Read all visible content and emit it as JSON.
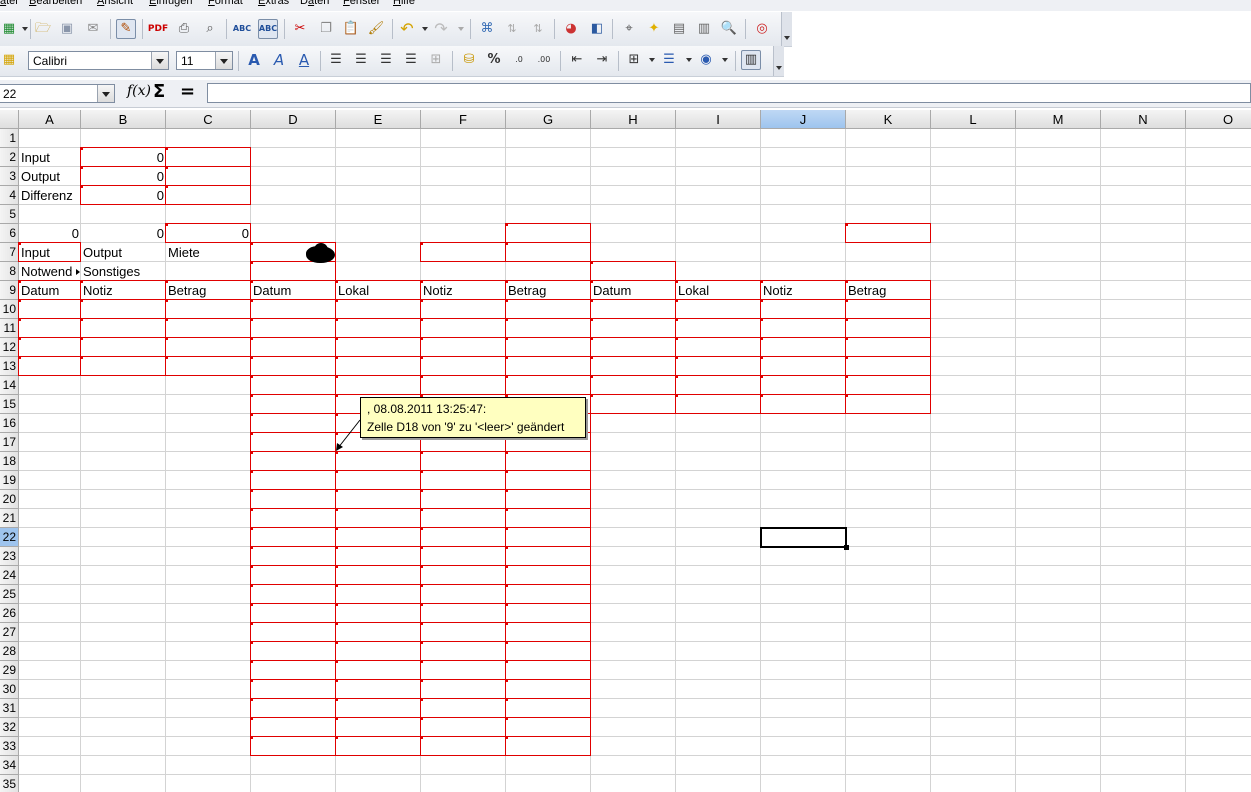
{
  "menu": [
    {
      "label": "atei",
      "underline": 0
    },
    {
      "label": "Bearbeiten",
      "underline": 0
    },
    {
      "label": "Ansicht",
      "underline": 0
    },
    {
      "label": "Einfügen",
      "underline": 0
    },
    {
      "label": "Format",
      "underline": 0
    },
    {
      "label": "Extras",
      "underline": 0
    },
    {
      "label": "Daten",
      "underline": 1
    },
    {
      "label": "Fenster",
      "underline": 0
    },
    {
      "label": "Hilfe",
      "underline": 0
    }
  ],
  "format_toolbar": {
    "font_name": "Calibri",
    "font_size": "11"
  },
  "formula_bar": {
    "cell_ref": "22",
    "content": ""
  },
  "columns": [
    "A",
    "B",
    "C",
    "D",
    "E",
    "F",
    "G",
    "H",
    "I",
    "J",
    "K",
    "L",
    "M",
    "N",
    "O"
  ],
  "rows": [
    "1",
    "2",
    "3",
    "4",
    "5",
    "6",
    "7",
    "8",
    "9",
    "10",
    "11",
    "12",
    "13",
    "14",
    "15",
    "16",
    "17",
    "18",
    "19",
    "20",
    "21",
    "22",
    "23",
    "24",
    "25",
    "26",
    "27",
    "28",
    "29",
    "30",
    "31",
    "32",
    "33",
    "34",
    "35"
  ],
  "row_labels_shown": [
    "1",
    "2",
    "3",
    "4",
    "5",
    "6",
    "7",
    "8",
    "9",
    "10",
    "11",
    "12",
    "13",
    "14",
    "15",
    "16",
    "17",
    "18",
    "19",
    "20",
    "21",
    "22",
    "23",
    "24",
    "25",
    "26",
    "27",
    "28",
    "29",
    "30",
    "31",
    "32",
    "33",
    "34",
    "35"
  ],
  "active": {
    "column": "J",
    "row": "22"
  },
  "cells": [
    {
      "ref": "A2",
      "value": "Input"
    },
    {
      "ref": "B2",
      "value": "0",
      "num": true
    },
    {
      "ref": "A3",
      "value": "Output"
    },
    {
      "ref": "B3",
      "value": "0",
      "num": true
    },
    {
      "ref": "A4",
      "value": "Differenz"
    },
    {
      "ref": "B4",
      "value": "0",
      "num": true
    },
    {
      "ref": "A6",
      "value": "0",
      "num": true
    },
    {
      "ref": "B6",
      "value": "0",
      "num": true
    },
    {
      "ref": "C6",
      "value": "0",
      "num": true
    },
    {
      "ref": "A7",
      "value": "Input"
    },
    {
      "ref": "B7",
      "value": "Output"
    },
    {
      "ref": "C7",
      "value": "Miete"
    },
    {
      "ref": "A8",
      "value": "Notwend"
    },
    {
      "ref": "B8",
      "value": "Sonstiges"
    },
    {
      "ref": "A9",
      "value": "Datum"
    },
    {
      "ref": "B9",
      "value": "Notiz"
    },
    {
      "ref": "C9",
      "value": "Betrag"
    },
    {
      "ref": "D9",
      "value": "Datum"
    },
    {
      "ref": "E9",
      "value": "Lokal"
    },
    {
      "ref": "F9",
      "value": "Notiz"
    },
    {
      "ref": "G9",
      "value": "Betrag"
    },
    {
      "ref": "H9",
      "value": "Datum"
    },
    {
      "ref": "I9",
      "value": "Lokal"
    },
    {
      "ref": "J9",
      "value": "Notiz"
    },
    {
      "ref": "K9",
      "value": "Betrag"
    }
  ],
  "comment": {
    "line1": ", 08.08.2011 13:25:47:",
    "line2": "Zelle D18 von '9' zu '<leer>' geändert"
  },
  "icons": {
    "new": "new-document-icon",
    "open": "open-folder-icon",
    "save": "save-icon",
    "mail": "email-icon",
    "edit": "edit-mode-icon",
    "pdf": "export-pdf-icon",
    "print": "print-icon",
    "preview": "print-preview-icon",
    "spell": "spellcheck-icon",
    "autospell": "autospellcheck-icon",
    "cut": "cut-icon",
    "copy": "copy-icon",
    "paste": "paste-icon",
    "brush": "format-paintbrush-icon",
    "undo": "undo-icon",
    "redo": "redo-icon",
    "hyperlink": "hyperlink-icon",
    "sortasc": "sort-ascending-icon",
    "sortdesc": "sort-descending-icon",
    "chart": "chart-icon",
    "pivot": "pivot-table-icon",
    "navigator": "navigator-icon",
    "gallery": "gallery-icon",
    "datasource": "data-sources-icon",
    "zoom": "zoom-icon",
    "help": "help-icon"
  }
}
